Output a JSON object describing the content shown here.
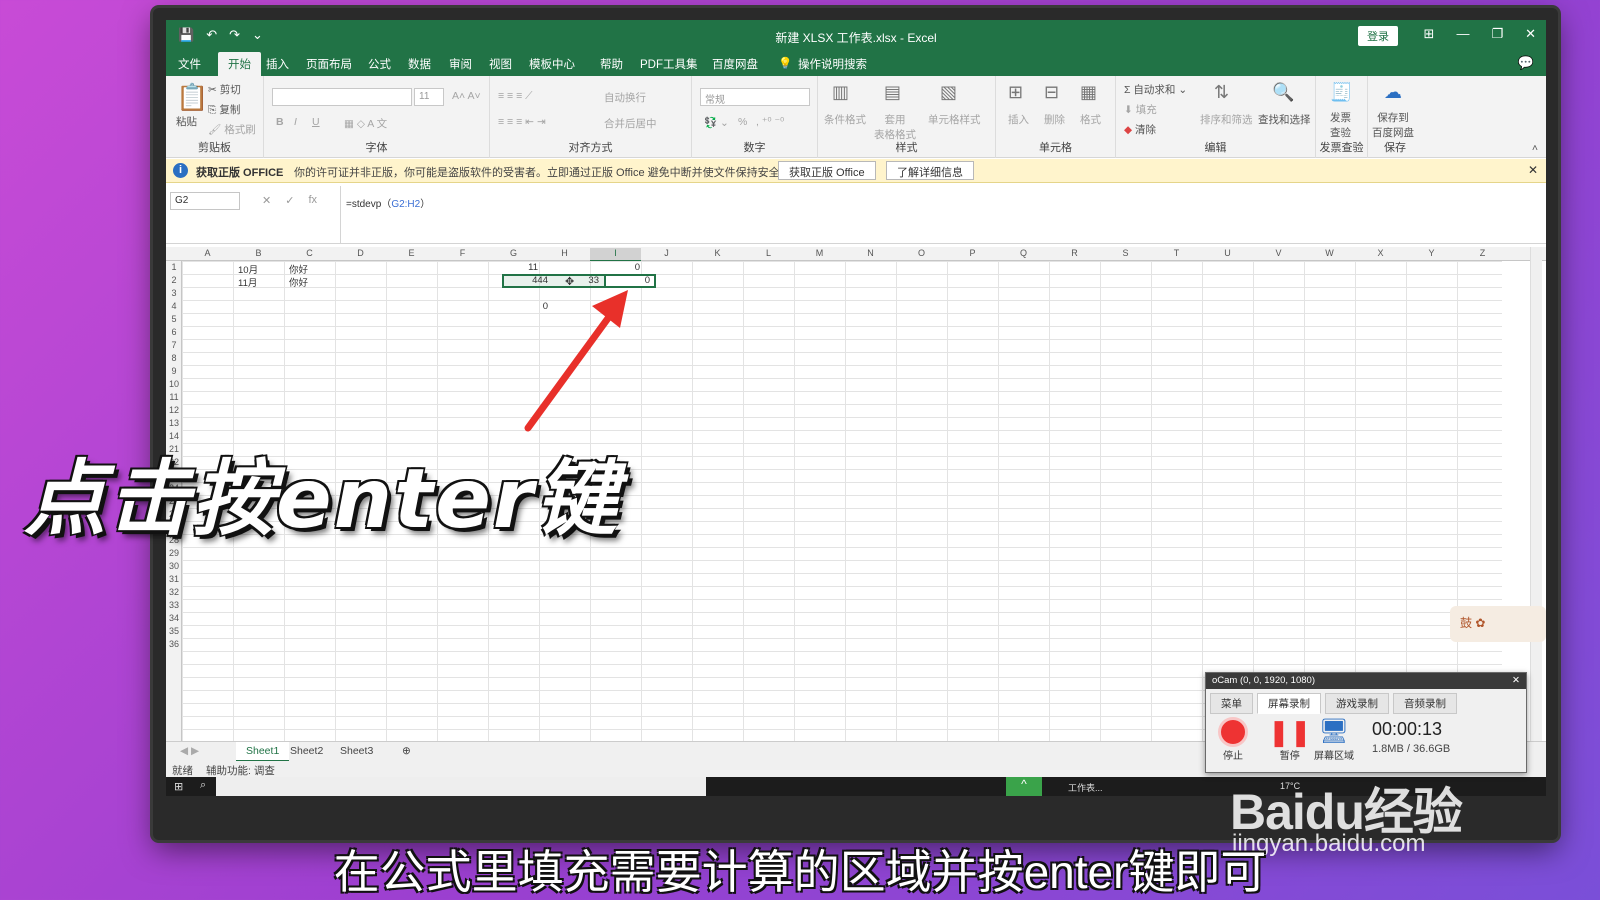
{
  "window": {
    "title": "新建 XLSX 工作表.xlsx  -  Excel",
    "login_label": "登录",
    "qat": [
      "💾",
      "↶",
      "↷",
      "⌄"
    ],
    "controls": [
      "⊞",
      "—",
      "❐",
      "✕"
    ]
  },
  "ribbon_tabs": [
    "文件",
    "开始",
    "插入",
    "页面布局",
    "公式",
    "数据",
    "审阅",
    "视图",
    "模板中心",
    "帮助",
    "PDF工具集",
    "百度网盘"
  ],
  "active_tab": "开始",
  "tell_me": "操作说明搜索",
  "ribbon": {
    "clipboard": {
      "paste": "粘贴",
      "cut": "剪切",
      "copy": "复制",
      "painter": "格式刷",
      "name": "剪贴板"
    },
    "font": {
      "size": "11",
      "name": "字体",
      "bold": "B",
      "italic": "I",
      "underline": "U"
    },
    "alignment": {
      "wrap": "自动换行",
      "merge": "合并后居中",
      "name": "对齐方式"
    },
    "number": {
      "format": "常规",
      "percent": "%",
      "name": "数字"
    },
    "styles": {
      "conditional": "条件格式",
      "table": "套用\n表格格式",
      "cell_styles": "单元格样式",
      "name": "样式"
    },
    "cells": {
      "insert": "插入",
      "delete": "删除",
      "format": "格式",
      "name": "单元格"
    },
    "editing": {
      "autosum": "自动求和",
      "fill": "填充",
      "clear": "清除",
      "sort": "排序和筛选",
      "find": "查找和选择",
      "name": "编辑"
    },
    "invoice": {
      "check": "发票\n查验",
      "name": "发票查验"
    },
    "save": {
      "save_to": "保存到\n百度网盘",
      "name": "保存"
    }
  },
  "notice": {
    "title": "获取正版 OFFICE",
    "message": "你的许可证并非正版，你可能是盗版软件的受害者。立即通过正版 Office 避免中断并使文件保持安全。",
    "btn_get": "获取正版 Office",
    "btn_learn": "了解详细信息"
  },
  "formula_bar": {
    "name_box": "G2",
    "formula_prefix": "=stdevp（",
    "formula_ref": "G2:H2",
    "formula_suffix": "）",
    "icons": [
      "✕",
      "✓",
      "fx"
    ]
  },
  "grid": {
    "columns": [
      "A",
      "B",
      "C",
      "D",
      "E",
      "F",
      "G",
      "H",
      "I",
      "J",
      "K",
      "L",
      "M",
      "N",
      "O",
      "P",
      "Q",
      "R",
      "S",
      "T",
      "U",
      "V",
      "W",
      "X",
      "Y",
      "Z"
    ],
    "selected_column": "I",
    "rows": [
      "1",
      "2",
      "3",
      "4",
      "5",
      "6",
      "7",
      "8",
      "9",
      "10",
      "11",
      "12",
      "13",
      "14",
      "21",
      "22",
      "23",
      "24",
      "25",
      "26",
      "27",
      "28",
      "29",
      "30",
      "31",
      "32",
      "33",
      "34",
      "35",
      "36"
    ],
    "cells": {
      "B1": "10月",
      "C1": "你好",
      "G1": "11",
      "I1": "0",
      "B2": "11月",
      "C2": "你好",
      "G2": "444",
      "H2": "33",
      "I2": "0",
      "G4": "0"
    }
  },
  "sheets": [
    "Sheet1",
    "Sheet2",
    "Sheet3"
  ],
  "active_sheet": "Sheet1",
  "status": {
    "ready": "就绪",
    "accessibility": "辅助功能: 调查"
  },
  "taskbar": {
    "temp": "17°C",
    "app": "工作表..."
  },
  "ocam": {
    "title": "oCam (0, 0, 1920, 1080)",
    "tabs": [
      "菜单",
      "屏幕录制",
      "游戏录制",
      "音频录制"
    ],
    "active_tab": "屏幕录制",
    "stop": "停止",
    "pause": "暂停",
    "screen": "屏幕区域",
    "time": "00:00:13",
    "size": "1.8MB / 36.6GB"
  },
  "overlay": {
    "big_caption": "点击按enter键",
    "sub_caption": "在公式里填充需要计算的区域并按enter键即可",
    "watermark": "Baidu经验",
    "watermark_url": "jingyan.baidu.com",
    "badge": "鼓 ✿"
  },
  "colors": {
    "excel_green": "#217346",
    "arrow": "#e8302a"
  }
}
